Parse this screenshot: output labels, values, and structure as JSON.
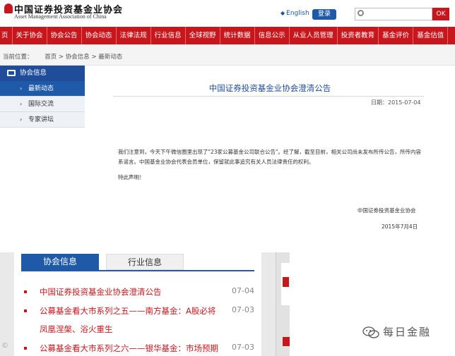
{
  "header": {
    "logo_cn": "中国证券投资基金业协会",
    "logo_en": "Asset Management Association of China",
    "lang_link": "English",
    "login_label": "登录",
    "search_button": "OK"
  },
  "nav": {
    "items": [
      "页",
      "关于协会",
      "协会公告",
      "协会动态",
      "法律法规",
      "行业信息",
      "全球视野",
      "统计数据",
      "信息公示",
      "从业人员管理",
      "投资者教育",
      "基金评价",
      "基金估值"
    ]
  },
  "breadcrumb": {
    "prefix": "当前位置：",
    "path": "首页 > 协会信息 > 最新动态"
  },
  "sidebar": {
    "title": "协会信息",
    "items": [
      {
        "label": "最新动态",
        "active": true
      },
      {
        "label": "国际交流",
        "active": false
      },
      {
        "label": "专家讲坛",
        "active": false
      }
    ]
  },
  "article": {
    "title": "中国证券投资基金业协会澄清公告",
    "date": "日期：2015-07-04",
    "paragraph1": "我们注意到，今天下午微信圈里出现了\"23家公募基金公司联合公告\"。经了解，截至目前，相关公司尚未发布所传公告，所传内容系谣言。中国基金业协会代表会员单位，保留就此事追究有关人员法律责任的权利。",
    "paragraph2": "特此声明！",
    "signature": "中国证券投资基金业协会",
    "signature_date": "2015年7月4日"
  },
  "lower": {
    "tab_active": "协会信息",
    "tab_inactive": "行业信息",
    "news": [
      {
        "title": "中国证券投资基金业协会澄清公告",
        "date": "07-04"
      },
      {
        "title": "公募基金看大市系列之五——南方基金：A股必将",
        "date": "07-03"
      },
      {
        "title": "凤凰涅槃、浴火重生",
        "date": ""
      },
      {
        "title": "公募基金看大市系列之六——银华基金：市场预期",
        "date": "07-03"
      }
    ]
  },
  "watermark": {
    "wechat": "每日金融"
  },
  "colors": {
    "brand_red": "#c8161d",
    "brand_blue": "#1f5aa8"
  }
}
